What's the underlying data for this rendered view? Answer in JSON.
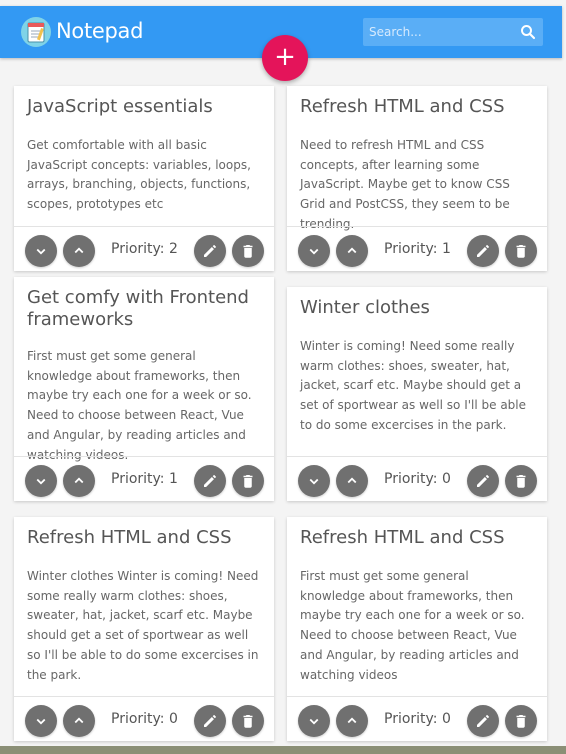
{
  "header": {
    "title": "Notepad",
    "search_placeholder": "Search..."
  },
  "add_button": {
    "label": "+"
  },
  "notes": [
    {
      "title": "JavaScript essentials",
      "text": "Get comfortable with all basic JavaScript concepts: variables, loops, arrays, branching, objects, functions, scopes, prototypes etc",
      "priority": "Priority: 2"
    },
    {
      "title": "Refresh HTML and CSS",
      "text": "Need to refresh HTML and CSS concepts, after learning some JavaScript. Maybe get to know CSS Grid and PostCSS, they seem to be trending.",
      "priority": "Priority: 1"
    },
    {
      "title": "Get comfy with Frontend frameworks",
      "text": "First must get some general knowledge about frameworks, then maybe try each one for a week or so. Need to choose between React, Vue and Angular, by reading articles and watching videos.",
      "priority": "Priority: 1"
    },
    {
      "title": "Winter clothes",
      "text": "Winter is coming! Need some really warm clothes: shoes, sweater, hat, jacket, scarf etc. Maybe should get a set of sportwear as well so I'll be able to do some excercises in the park.",
      "priority": "Priority: 0"
    },
    {
      "title": "Refresh HTML and CSS",
      "text": "Winter clothes Winter is coming! Need some really warm clothes: shoes, sweater, hat, jacket, scarf etc. Maybe should get a set of sportwear as well so I'll be able to do some excercises in the park.",
      "priority": "Priority: 0"
    },
    {
      "title": "Refresh HTML and CSS",
      "text": "First must get some general knowledge about frameworks, then maybe try each one for a week or so. Need to choose between React, Vue and Angular, by reading articles and watching videos",
      "priority": "Priority: 0"
    }
  ],
  "icons": {
    "logo": "notepad-icon",
    "search": "search-icon",
    "down": "chevron-down-icon",
    "up": "chevron-up-icon",
    "edit": "pencil-icon",
    "delete": "trash-icon"
  },
  "colors": {
    "header": "#3399f3",
    "add_button": "#e4145a",
    "action_button": "#707070"
  }
}
